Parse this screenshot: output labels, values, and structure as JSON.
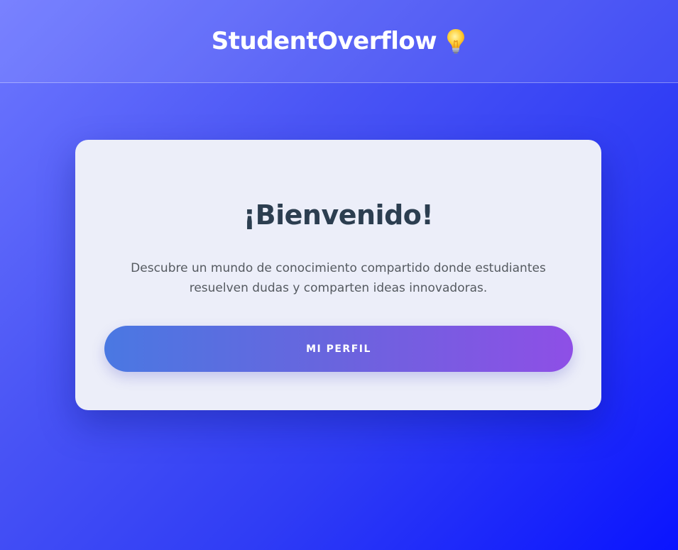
{
  "header": {
    "brand": "StudentOverflow",
    "brand_icon": "lightbulb-icon"
  },
  "welcome_card": {
    "title": "¡Bienvenido!",
    "description": "Descubre un mundo de conocimiento compartido donde estudiantes resuelven dudas y comparten ideas innovadoras.",
    "profile_button_label": "MI PERFIL"
  },
  "colors": {
    "background_start": "#6e78ff",
    "background_end": "#0a14ff",
    "card_background": "#eceef9",
    "title_color": "#2c3e50",
    "button_start": "#4a78e2",
    "button_end": "#8e4fe6"
  }
}
